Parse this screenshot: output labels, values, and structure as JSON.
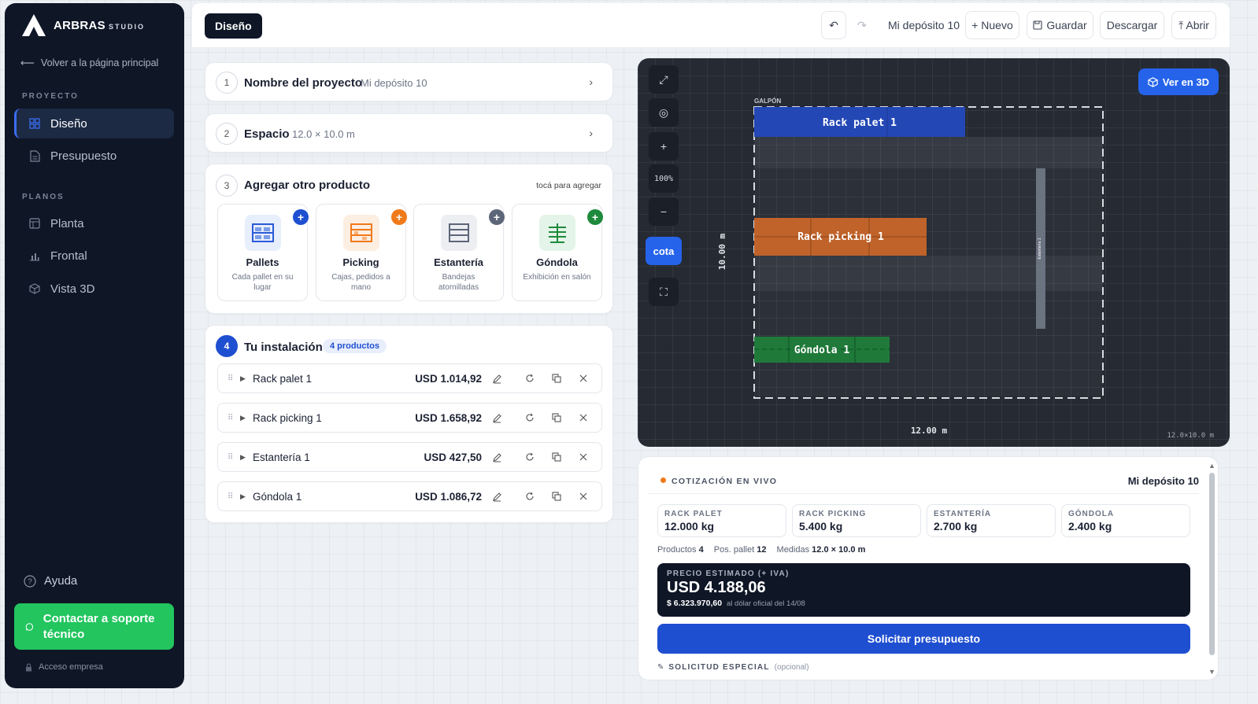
{
  "brand": {
    "name": "ARBRAS",
    "suffix": "STUDIO"
  },
  "sidebar": {
    "back_label": "Volver a la página principal",
    "section_project": "PROYECTO",
    "project_items": [
      {
        "label": "Diseño",
        "icon": "grid-icon",
        "active": true
      },
      {
        "label": "Presupuesto",
        "icon": "document-icon",
        "active": false
      }
    ],
    "section_plans": "PLANOS",
    "plan_items": [
      {
        "label": "Planta",
        "icon": "layout-icon"
      },
      {
        "label": "Frontal",
        "icon": "bar-chart-icon"
      },
      {
        "label": "Vista 3D",
        "icon": "cube-icon"
      }
    ],
    "help_label": "Ayuda",
    "support_label": "Contactar a soporte técnico",
    "access_label": "Acceso empresa"
  },
  "topbar": {
    "tab_label": "Diseño",
    "project_name": "Mi depósito 10",
    "new_label": "+ Nuevo",
    "save_label": "Guardar",
    "download_label": "Descargar",
    "open_label": "⤒ Abrir"
  },
  "steps": {
    "s1": {
      "num": "1",
      "title": "Nombre del proyecto",
      "value": "Mi depósito 10"
    },
    "s2": {
      "num": "2",
      "title": "Espacio",
      "value": "12.0 × 10.0 m"
    },
    "s3": {
      "num": "3",
      "title": "Agregar otro producto",
      "hint": "tocá para agregar",
      "products": [
        {
          "name": "Pallets",
          "desc": "Cada pallet en su lugar",
          "color": "#1f4fd1"
        },
        {
          "name": "Picking",
          "desc": "Cajas, pedidos a mano",
          "color": "#f07a1a"
        },
        {
          "name": "Estantería",
          "desc": "Bandejas atornilladas",
          "color": "#5d6679"
        },
        {
          "name": "Góndola",
          "desc": "Exhibición en salón",
          "color": "#1e8a3c"
        }
      ]
    },
    "s4": {
      "num": "4",
      "title": "Tu instalación",
      "badge": "4 productos",
      "items": [
        {
          "name": "Rack palet 1",
          "price": "USD 1.014,92"
        },
        {
          "name": "Rack picking 1",
          "price": "USD 1.658,92"
        },
        {
          "name": "Estantería 1",
          "price": "USD 427,50"
        },
        {
          "name": "Góndola 1",
          "price": "USD 1.086,72"
        }
      ]
    }
  },
  "canvas": {
    "zoom_label": "100%",
    "cota_label": "cota",
    "view3d_label": "Ver en 3D",
    "area_label": "GALPÓN",
    "blocks": {
      "rack_palet": "Rack palet 1",
      "rack_picking": "Rack picking 1",
      "gondola": "Góndola 1",
      "estanteria": "Estantería 1"
    },
    "height_label": "10.00 m",
    "width_label": "12.00 m",
    "size_label": "12.0×10.0 m",
    "colors": {
      "rack_palet": "#2347b5",
      "rack_picking": "#c0632a",
      "gondola": "#1f7a3a",
      "estanteria": "#6b7280"
    }
  },
  "quote": {
    "title": "COTIZACIÓN EN VIVO",
    "project": "Mi depósito 10",
    "kpis": [
      {
        "label": "RACK PALET",
        "value": "12.000 kg"
      },
      {
        "label": "RACK PICKING",
        "value": "5.400 kg"
      },
      {
        "label": "ESTANTERÍA",
        "value": "2.700 kg"
      },
      {
        "label": "GÓNDOLA",
        "value": "2.400 kg"
      }
    ],
    "products_label": "Productos",
    "products_value": "4",
    "pallet_label": "Pos. pallet",
    "pallet_value": "12",
    "measures_label": "Medidas",
    "measures_value": "12.0 × 10.0 m",
    "price_label": "PRECIO ESTIMADO (+ IVA)",
    "price_value": "USD 4.188,06",
    "ars_value": "$ 6.323.970,60",
    "ars_note": "al dólar oficial del 14/08",
    "request_label": "Solicitar presupuesto",
    "special_label": "SOLICITUD ESPECIAL",
    "special_optional": "(opcional)"
  }
}
